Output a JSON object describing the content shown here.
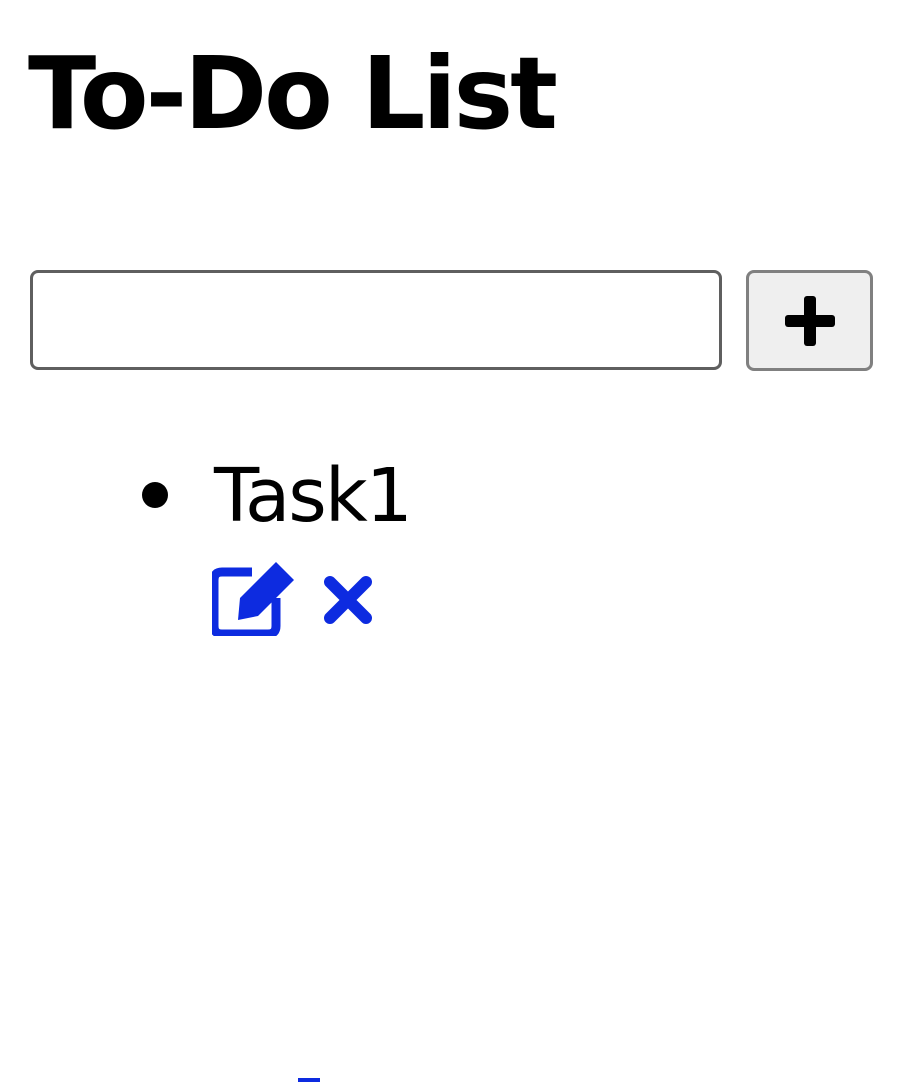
{
  "page": {
    "title": "To-Do List"
  },
  "form": {
    "input_value": "",
    "add_button_icon": "plus-icon"
  },
  "tasks": [
    {
      "label": "Task1",
      "edit_icon": "edit-icon",
      "delete_icon": "close-icon"
    }
  ],
  "colors": {
    "text": "#000000",
    "action_icons": "#0d2be0",
    "input_border": "#5f5f5f",
    "button_background": "#efefef",
    "button_border": "#808080"
  }
}
